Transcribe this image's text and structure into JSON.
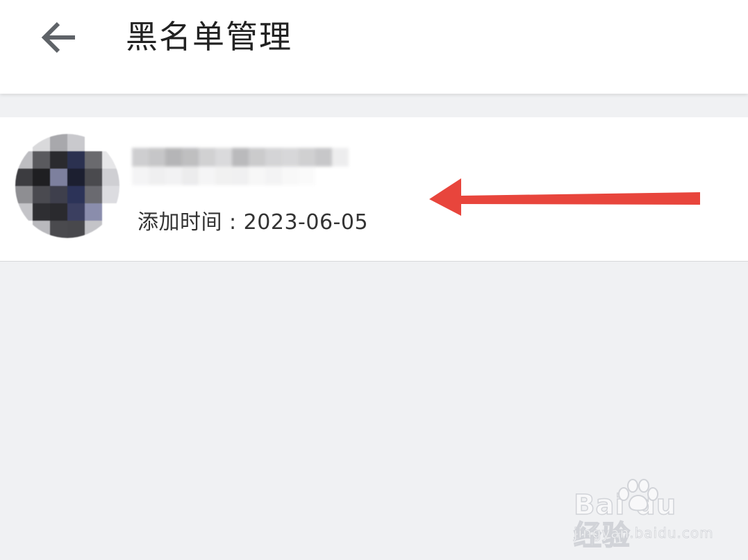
{
  "header": {
    "back_icon": "arrow-left-icon",
    "title": "黑名单管理"
  },
  "blacklist": {
    "items": [
      {
        "avatar": "pixelated-avatar",
        "name_obscured": true,
        "added_time_label": "添加时间 : 2023-06-05"
      }
    ]
  },
  "annotation": {
    "arrow_icon": "red-arrow-left-icon",
    "color": "#e8453c"
  },
  "watermark": {
    "logo": "Baidu经验",
    "url": "jingyan.baidu.com"
  },
  "colors": {
    "background": "#f0f1f3",
    "surface": "#ffffff",
    "text_primary": "#222222",
    "text_secondary": "#333333",
    "icon": "#5f6368",
    "divider": "#d6d7d9"
  }
}
